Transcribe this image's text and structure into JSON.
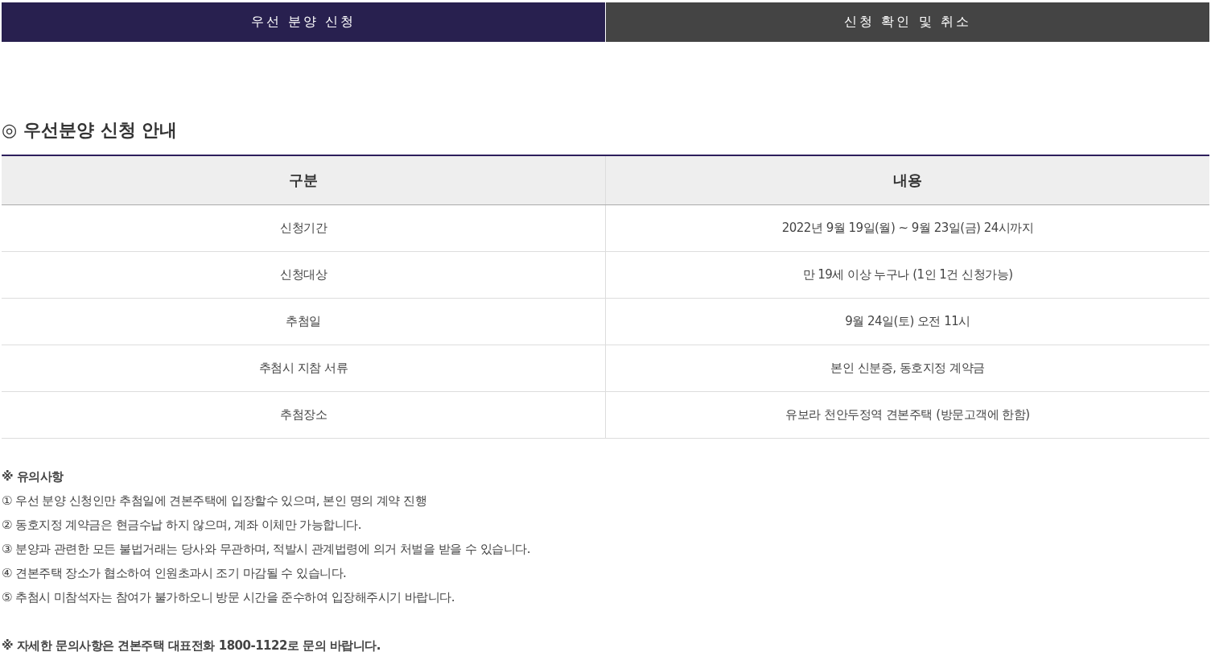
{
  "tabs": [
    {
      "label": "우선 분양 신청",
      "selected": true
    },
    {
      "label": "신청 확인 및 취소",
      "selected": false
    }
  ],
  "section": {
    "title": "◎ 우선분양 신청 안내"
  },
  "table": {
    "columns": [
      "구분",
      "내용"
    ],
    "rows": [
      [
        "신청기간",
        "2022년 9월 19일(월) ~ 9월 23일(금) 24시까지"
      ],
      [
        "신청대상",
        "만 19세 이상 누구나 (1인 1건 신청가능)"
      ],
      [
        "추첨일",
        "9월 24일(토) 오전 11시"
      ],
      [
        "추첨시 지참 서류",
        "본인 신분증, 동호지정 계약금"
      ],
      [
        "추첨장소",
        "유보라 천안두정역 견본주택 (방문고객에 한함)"
      ]
    ]
  },
  "notes": {
    "title": "※ 유의사항",
    "items": [
      "① 우선 분양 신청인만 추첨일에 견본주택에 입장할수 있으며, 본인 명의 계약 진행",
      "② 동호지정 계약금은 현금수납 하지 않으며, 계좌 이체만 가능합니다.",
      "③ 분양과 관련한 모든 불법거래는 당사와 무관하며, 적발시 관계법령에 의거 처벌을 받을 수 있습니다.",
      "④ 견본주택 장소가 협소하여 인원초과시 조기 마감될 수 있습니다.",
      "⑤ 추첨시 미참석자는 참여가 불가하오니 방문 시간을 준수하여 입장해주시기 바랍니다."
    ],
    "contact": "※ 자세한 문의사항은 견본주택 대표전화 1800-1122로 문의 바랍니다."
  }
}
